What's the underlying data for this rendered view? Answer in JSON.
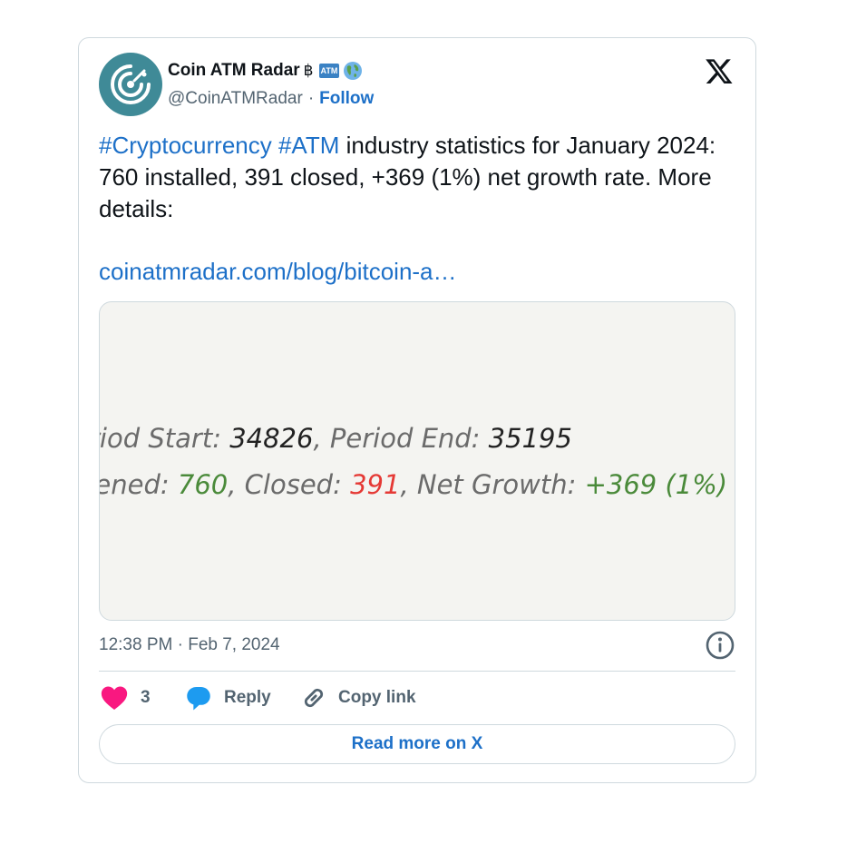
{
  "author": {
    "name": "Coin ATM Radar",
    "name_emoji": "฿",
    "atm_badge": "ATM",
    "handle": "@CoinATMRadar",
    "separator": "·",
    "follow_label": "Follow"
  },
  "tweet": {
    "hashtag1": "#Cryptocurrency",
    "hashtag2": "#ATM",
    "text": " industry statistics for January 2024: 760 installed, 391 closed, +369 (1%) net growth rate.  More details:",
    "link": "coinatmradar.com/blog/bitcoin-a…"
  },
  "media": {
    "line1_label1": "riod Start: ",
    "line1_value1": "34826",
    "line1_label2": ", Period End: ",
    "line1_value2": "35195",
    "line2_label1": "pened:  ",
    "line2_value1": "760",
    "line2_label2": ", Closed:  ",
    "line2_value2": "391",
    "line2_label3": ", Net Growth:  ",
    "line2_value3": "+369 (1%)"
  },
  "timestamp": "12:38 PM · Feb 7, 2024",
  "actions": {
    "like_count": "3",
    "reply_label": "Reply",
    "copy_label": "Copy link"
  },
  "read_more_label": "Read more on X",
  "colors": {
    "accent": "#1d70c8",
    "heart": "#f91880",
    "avatar_bg": "#3f8a97",
    "green_value": "#4a8a3a",
    "red_value": "#e53935"
  }
}
